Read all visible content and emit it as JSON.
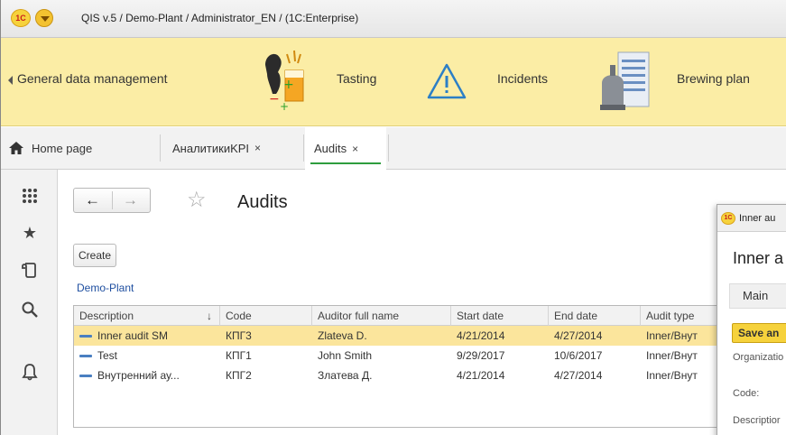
{
  "window": {
    "title": "QIS v.5 / Demo-Plant / Administrator_EN /  (1C:Enterprise)",
    "logo_text": "1C"
  },
  "sections": [
    {
      "label": "General data management",
      "icon": "general-data-icon"
    },
    {
      "label": "Tasting",
      "icon": "tasting-icon"
    },
    {
      "label": "Incidents",
      "icon": "warning-icon"
    },
    {
      "label": "Brewing plan",
      "icon": "brewing-plan-icon"
    }
  ],
  "tabs": [
    {
      "label": "Home page",
      "icon": "home-icon"
    },
    {
      "label": "АналитикиKPI",
      "close": "×"
    },
    {
      "label": "Audits",
      "close": "×",
      "active": true
    }
  ],
  "page": {
    "title": "Audits",
    "create_label": "Create",
    "org_link": "Demo-Plant"
  },
  "table": {
    "columns": [
      "Description",
      "Code",
      "Auditor full name",
      "Start date",
      "End date",
      "Audit type"
    ],
    "sort_indicator": "↓",
    "rows": [
      [
        "Inner audit SM",
        "КПГ3",
        "Zlateva D.",
        "4/21/2014",
        "4/27/2014",
        "Inner/Внут"
      ],
      [
        "Test",
        "КПГ1",
        "John Smith",
        "9/29/2017",
        "10/6/2017",
        "Inner/Внут"
      ],
      [
        "Внутренний ау...",
        "КПГ2",
        "Златева Д.",
        "4/21/2014",
        "4/27/2014",
        "Inner/Внут"
      ]
    ],
    "selected_row": 0
  },
  "dialog": {
    "title": "Inner au",
    "heading": "Inner a",
    "tab_label": "Main",
    "save_label": "Save an",
    "fields": [
      "Organizatio",
      "Code:",
      "Descriptior"
    ]
  },
  "colors": {
    "sections_bg": "#fbeda5",
    "selected_row": "#fbe59c",
    "active_tab_underline": "#2e9d3e",
    "link": "#1f4fa0",
    "save_button": "#f6d23c"
  }
}
